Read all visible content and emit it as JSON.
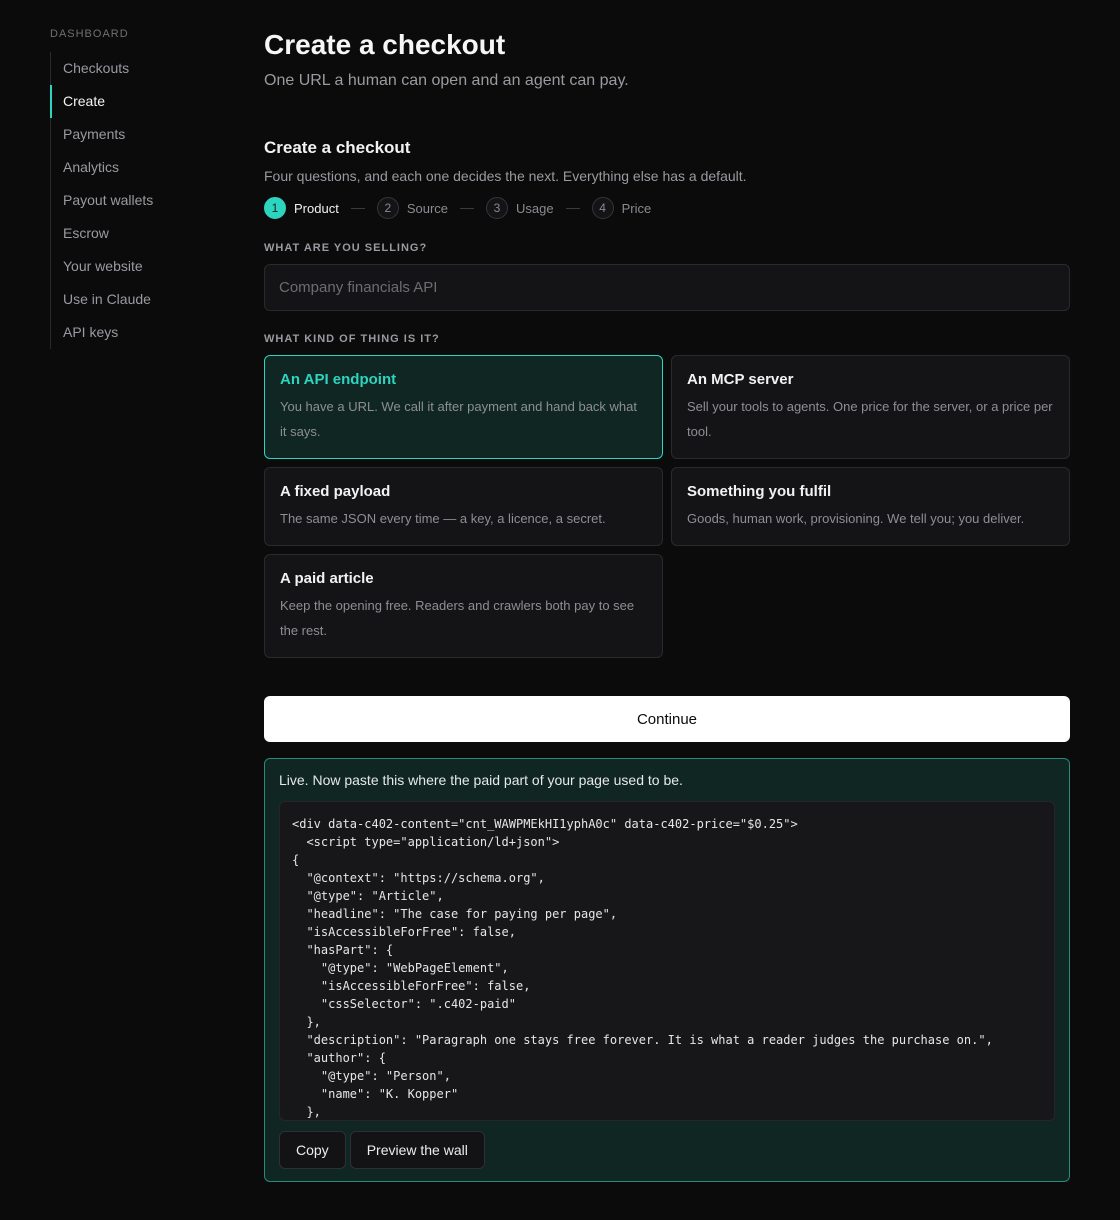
{
  "sidebar": {
    "heading": "DASHBOARD",
    "items": [
      {
        "label": "Checkouts"
      },
      {
        "label": "Create"
      },
      {
        "label": "Payments"
      },
      {
        "label": "Analytics"
      },
      {
        "label": "Payout wallets"
      },
      {
        "label": "Escrow"
      },
      {
        "label": "Your website"
      },
      {
        "label": "Use in Claude"
      },
      {
        "label": "API keys"
      }
    ],
    "active": "Create"
  },
  "header": {
    "title": "Create a checkout",
    "subtitle": "One URL a human can open and an agent can pay."
  },
  "section": {
    "title": "Create a checkout",
    "description": "Four questions, and each one decides the next. Everything else has a default."
  },
  "stepper": {
    "steps": [
      {
        "num": "1",
        "label": "Product"
      },
      {
        "num": "2",
        "label": "Source"
      },
      {
        "num": "3",
        "label": "Usage"
      },
      {
        "num": "4",
        "label": "Price"
      }
    ],
    "active_step": 1
  },
  "selling": {
    "label": "WHAT ARE YOU SELLING?",
    "value": "",
    "placeholder": "Company financials API"
  },
  "kind": {
    "label": "WHAT KIND OF THING IS IT?",
    "options": [
      {
        "title": "An API endpoint",
        "description": "You have a URL. We call it after payment and hand back what it says."
      },
      {
        "title": "An MCP server",
        "description": "Sell your tools to agents. One price for the server, or a price per tool."
      },
      {
        "title": "A fixed payload",
        "description": "The same JSON every time — a key, a licence, a secret."
      },
      {
        "title": "Something you fulfil",
        "description": "Goods, human work, provisioning. We tell you; you deliver."
      },
      {
        "title": "A paid article",
        "description": "Keep the opening free. Readers and crawlers both pay to see the rest."
      }
    ],
    "selected": "An API endpoint"
  },
  "continue_label": "Continue",
  "live": {
    "message": "Live. Now paste this where the paid part of your page used to be.",
    "code": "<div data-c402-content=\"cnt_WAWPMEkHI1yphA0c\" data-c402-price=\"$0.25\">\n  <script type=\"application/ld+json\">\n{\n  \"@context\": \"https://schema.org\",\n  \"@type\": \"Article\",\n  \"headline\": \"The case for paying per page\",\n  \"isAccessibleForFree\": false,\n  \"hasPart\": {\n    \"@type\": \"WebPageElement\",\n    \"isAccessibleForFree\": false,\n    \"cssSelector\": \".c402-paid\"\n  },\n  \"description\": \"Paragraph one stays free forever. It is what a reader judges the purchase on.\",\n  \"author\": {\n    \"@type\": \"Person\",\n    \"name\": \"K. Kopper\"\n  },",
    "copy_label": "Copy",
    "preview_label": "Preview the wall"
  },
  "colors": {
    "accent": "#2dd4bf",
    "background": "#0b0b0c",
    "selected_card_bg": "#0f2623"
  }
}
